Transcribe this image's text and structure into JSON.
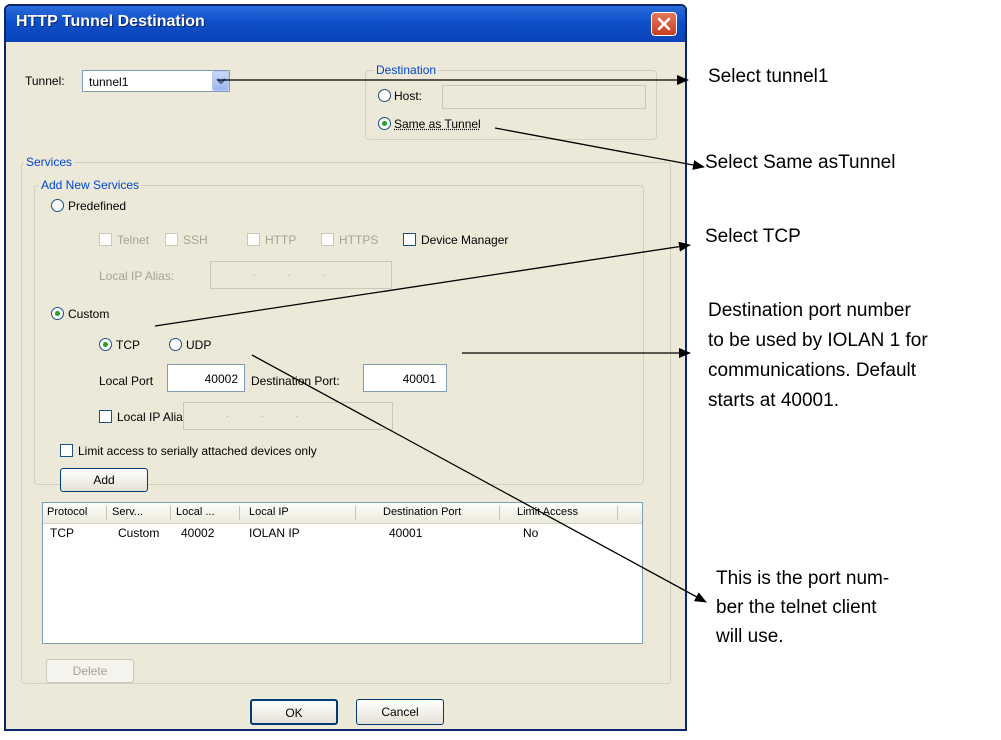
{
  "dialog": {
    "title": "HTTP Tunnel Destination",
    "tunnel_label": "Tunnel:",
    "tunnel_value": "tunnel1",
    "destination": {
      "legend": "Destination",
      "host_label": "Host:",
      "host_value": "",
      "same_as_tunnel_label": "Same as Tunnel",
      "selected": "same_as_tunnel"
    },
    "services": {
      "legend": "Services",
      "add_new_legend": "Add New Services",
      "predefined_label": "Predefined",
      "predefined_options": [
        "Telnet",
        "SSH",
        "HTTP",
        "HTTPS",
        "Device Manager"
      ],
      "local_ip_alias_label": "Local IP Alias:",
      "custom_label": "Custom",
      "tcp_label": "TCP",
      "udp_label": "UDP",
      "local_port_label": "Local Port",
      "local_port_value": "40002",
      "destination_port_label": "Destination Port:",
      "destination_port_value": "40001",
      "custom_local_ip_alias_label": "Local IP Alias:",
      "limit_access_label": "Limit access to serially attached devices only",
      "add_button": "Add"
    },
    "table": {
      "columns": [
        "Protocol",
        "Serv...",
        "Local ...",
        "Local IP",
        "Destination Port",
        "Limit Access"
      ],
      "rows": [
        [
          "TCP",
          "Custom",
          "40002",
          "IOLAN IP",
          "40001",
          "No"
        ]
      ]
    },
    "delete_button": "Delete",
    "ok_button": "OK",
    "cancel_button": "Cancel"
  },
  "annotations": {
    "select_tunnel": "Select tunnel1",
    "select_same": "Select Same asTunnel",
    "select_tcp": "Select TCP",
    "dest_port_lines": [
      "Destination port number",
      "to be used by IOLAN 1 for",
      "communications. Default",
      "starts at 40001."
    ],
    "local_port_lines": [
      "This is the port num-",
      "ber the telnet client",
      "will use."
    ]
  }
}
